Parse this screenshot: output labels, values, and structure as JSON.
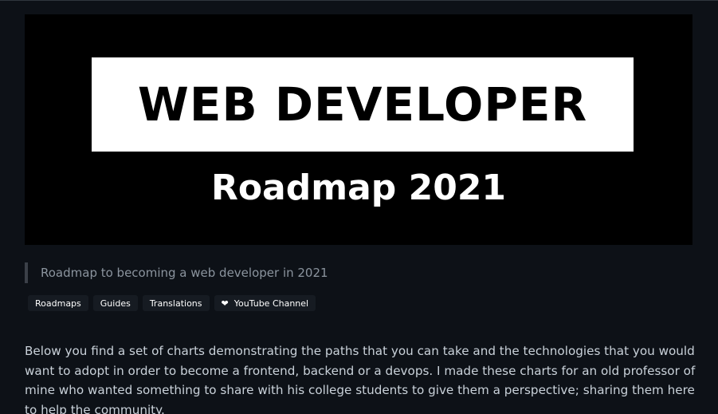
{
  "banner": {
    "title": "WEB DEVELOPER",
    "subtitle": "Roadmap 2021"
  },
  "tagline": "Roadmap to becoming a web developer in 2021",
  "links": [
    {
      "label": "Roadmaps",
      "icon": ""
    },
    {
      "label": "Guides",
      "icon": ""
    },
    {
      "label": "Translations",
      "icon": ""
    },
    {
      "label": "YouTube Channel",
      "icon": "heart-icon"
    }
  ],
  "description": "Below you find a set of charts demonstrating the paths that you can take and the technologies that you would want to adopt in order to become a frontend, backend or a devops. I made these charts for an old professor of mine who wanted something to share with his college students to give them a perspective; sharing them here to help the community.",
  "colors": {
    "background": "#0d1117",
    "banner_background": "#000000",
    "banner_box": "#ffffff",
    "text": "#c9d1d9",
    "muted_text": "#8b949e",
    "pill_background": "#161b22"
  }
}
